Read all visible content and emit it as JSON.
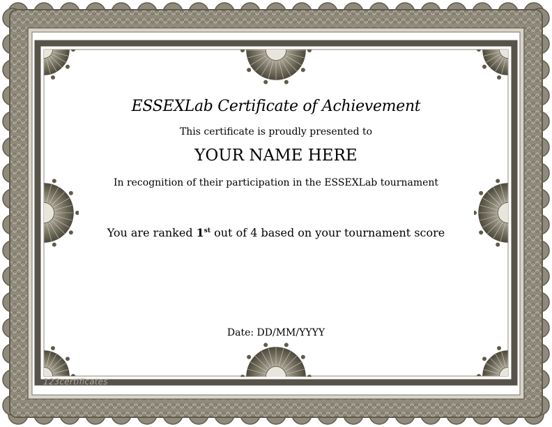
{
  "certificate": {
    "title": "ESSEXLab Certificate of Achievement",
    "presented_to": "This certificate is proudly presented to",
    "recipient_name": "YOUR NAME HERE",
    "recognition": "In recognition of their participation in the ESSEXLab tournament",
    "rank_prefix": "You are ranked ",
    "rank_number": "1",
    "rank_suffix_sup": "st",
    "rank_text_after": " out of 4 based on your tournament score",
    "date": "Date: DD/MM/YYYY"
  },
  "watermark": "123certificates",
  "colors": {
    "border_dark": "#5f5a4a",
    "border_mid": "#8d8778",
    "border_light": "#c9c4b8",
    "inner_band": "#57534a"
  },
  "ornaments": [
    "rosette-corner-ornament",
    "rosette-half-medallion-ornament",
    "guilloche-scalloped-border"
  ]
}
